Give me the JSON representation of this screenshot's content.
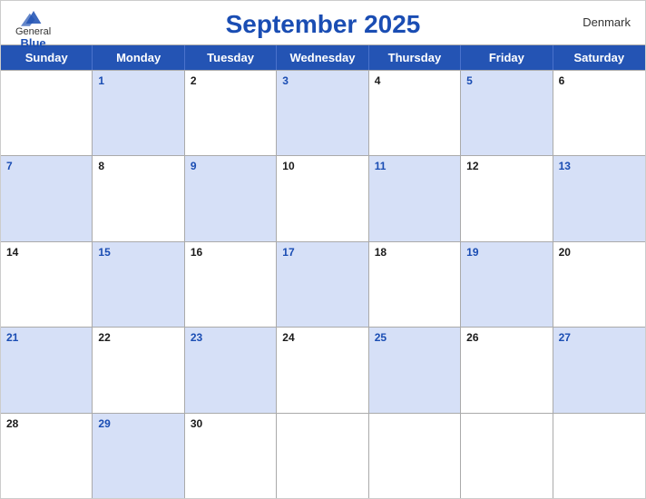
{
  "header": {
    "logo": {
      "general": "General",
      "blue": "Blue",
      "icon_color": "#1a4db3"
    },
    "title": "September 2025",
    "country": "Denmark"
  },
  "days_of_week": [
    "Sunday",
    "Monday",
    "Tuesday",
    "Wednesday",
    "Thursday",
    "Friday",
    "Saturday"
  ],
  "weeks": [
    [
      {
        "num": "",
        "shaded": false,
        "empty": true
      },
      {
        "num": "1",
        "shaded": true
      },
      {
        "num": "2",
        "shaded": false
      },
      {
        "num": "3",
        "shaded": true
      },
      {
        "num": "4",
        "shaded": false
      },
      {
        "num": "5",
        "shaded": true
      },
      {
        "num": "6",
        "shaded": false
      }
    ],
    [
      {
        "num": "7",
        "shaded": true
      },
      {
        "num": "8",
        "shaded": false
      },
      {
        "num": "9",
        "shaded": true
      },
      {
        "num": "10",
        "shaded": false
      },
      {
        "num": "11",
        "shaded": true
      },
      {
        "num": "12",
        "shaded": false
      },
      {
        "num": "13",
        "shaded": true
      }
    ],
    [
      {
        "num": "14",
        "shaded": false
      },
      {
        "num": "15",
        "shaded": true
      },
      {
        "num": "16",
        "shaded": false
      },
      {
        "num": "17",
        "shaded": true
      },
      {
        "num": "18",
        "shaded": false
      },
      {
        "num": "19",
        "shaded": true
      },
      {
        "num": "20",
        "shaded": false
      }
    ],
    [
      {
        "num": "21",
        "shaded": true
      },
      {
        "num": "22",
        "shaded": false
      },
      {
        "num": "23",
        "shaded": true
      },
      {
        "num": "24",
        "shaded": false
      },
      {
        "num": "25",
        "shaded": true
      },
      {
        "num": "26",
        "shaded": false
      },
      {
        "num": "27",
        "shaded": true
      }
    ],
    [
      {
        "num": "28",
        "shaded": false
      },
      {
        "num": "29",
        "shaded": true
      },
      {
        "num": "30",
        "shaded": false
      },
      {
        "num": "",
        "shaded": false,
        "empty": true
      },
      {
        "num": "",
        "shaded": false,
        "empty": true
      },
      {
        "num": "",
        "shaded": false,
        "empty": true
      },
      {
        "num": "",
        "shaded": false,
        "empty": true
      }
    ]
  ]
}
